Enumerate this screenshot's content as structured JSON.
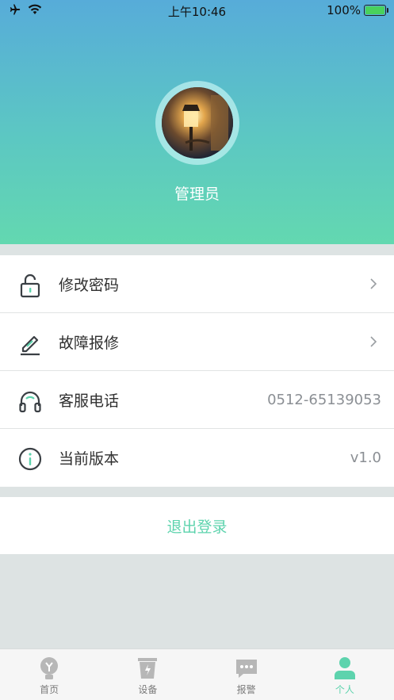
{
  "status_bar": {
    "time": "上午10:46",
    "battery": "100%"
  },
  "profile": {
    "name": "管理员"
  },
  "menu": [
    {
      "label": "修改密码",
      "value": "",
      "icon": "unlock-icon"
    },
    {
      "label": "故障报修",
      "value": "",
      "icon": "edit-icon"
    },
    {
      "label": "客服电话",
      "value": "0512-65139053",
      "icon": "headphones-icon"
    },
    {
      "label": "当前版本",
      "value": "v1.0",
      "icon": "info-icon"
    }
  ],
  "logout_label": "退出登录",
  "tabs": [
    {
      "label": "首页",
      "active": false
    },
    {
      "label": "设备",
      "active": false
    },
    {
      "label": "报警",
      "active": false
    },
    {
      "label": "个人",
      "active": true
    }
  ],
  "colors": {
    "accent": "#5dd3ad",
    "inactive_tab": "#b7b7b7"
  }
}
